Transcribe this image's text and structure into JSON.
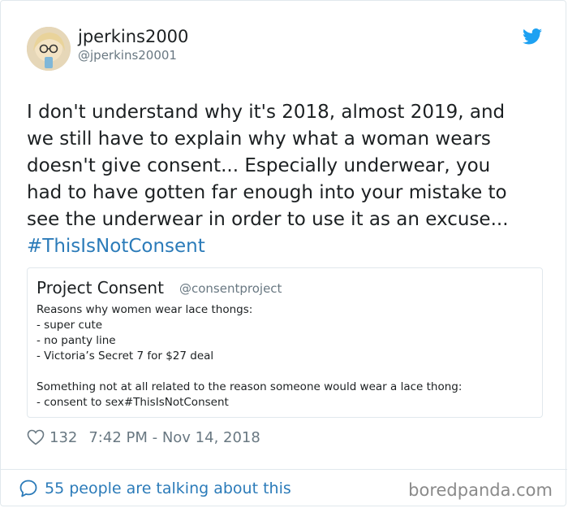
{
  "tweet": {
    "display_name": "jperkins2000",
    "handle": "@jperkins20001",
    "text_lines": [
      "I don't understand why it's 2018, almost 2019, and",
      "we still have to explain why what a woman wears",
      "doesn't give consent... Especially underwear, you",
      "had to have gotten far enough into your mistake to",
      "see the underwear in order to use it as an excuse..."
    ],
    "hashtag": "#ThisIsNotConsent",
    "likes": "132",
    "timestamp": "7:42 PM - Nov 14, 2018",
    "talking_about": "55 people are talking about this"
  },
  "quote": {
    "name": "Project Consent",
    "handle": "@consentproject",
    "lines": [
      "Reasons why women wear lace thongs:",
      "- super cute",
      "- no panty line",
      "- Victoria’s Secret 7 for $27 deal",
      "",
      "Something not at all related to the reason someone would wear a lace thong:",
      "- consent to sex#ThisIsNotConsent"
    ]
  },
  "watermark": "boredpanda.com",
  "icons": {
    "brand": "twitter-bird-icon",
    "like": "heart-icon",
    "reply": "speech-bubble-icon"
  },
  "colors": {
    "link": "#2b7bb9",
    "brand": "#1da1f2",
    "muted": "#697882",
    "border": "#e1e8ed"
  }
}
